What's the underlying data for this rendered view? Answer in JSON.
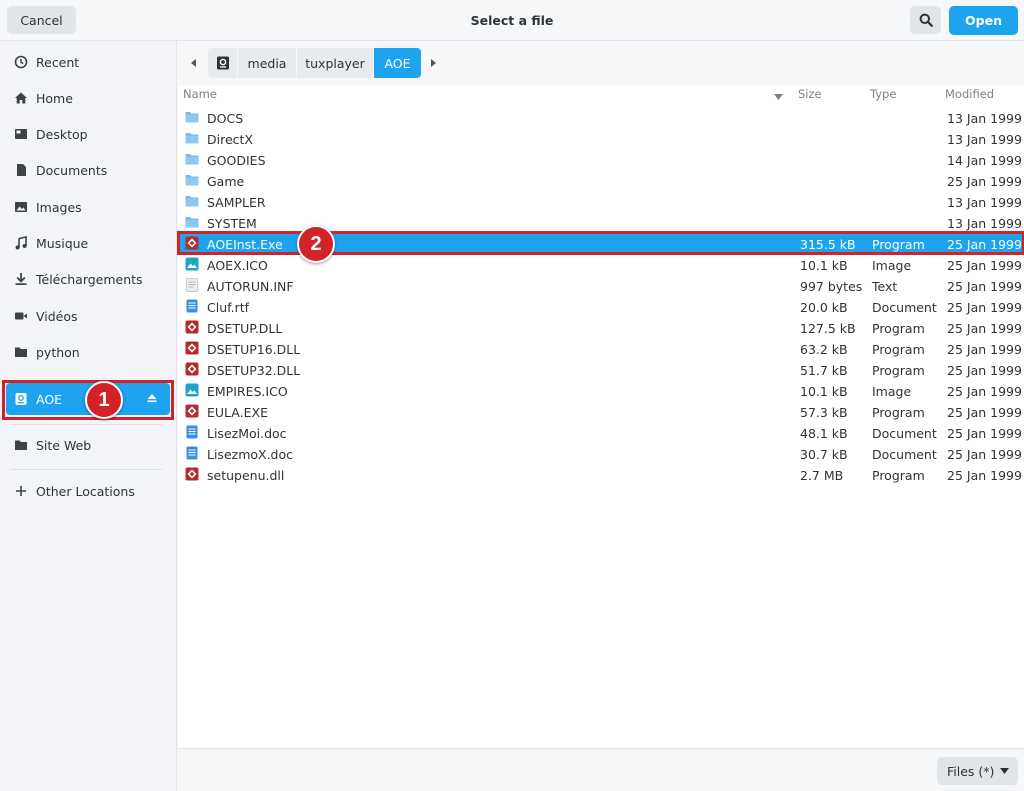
{
  "header": {
    "cancel_label": "Cancel",
    "title": "Select a file",
    "open_label": "Open",
    "accent": "#1ea4ef"
  },
  "sidebar": {
    "items": [
      {
        "label": "Recent",
        "icon": "clock-icon"
      },
      {
        "label": "Home",
        "icon": "home-icon"
      },
      {
        "label": "Desktop",
        "icon": "desktop-icon"
      },
      {
        "label": "Documents",
        "icon": "document-icon"
      },
      {
        "label": "Images",
        "icon": "image-icon"
      },
      {
        "label": "Musique",
        "icon": "music-icon"
      },
      {
        "label": "Téléchargements",
        "icon": "download-icon"
      },
      {
        "label": "Vidéos",
        "icon": "video-icon"
      },
      {
        "label": "python",
        "icon": "folder-icon"
      },
      {
        "label": "AOE",
        "icon": "drive-icon",
        "active": true
      },
      {
        "label": "Site Web",
        "icon": "folder-icon"
      },
      {
        "label": "Other Locations",
        "icon": "plus-icon"
      }
    ]
  },
  "callouts": [
    "1",
    "2"
  ],
  "pathbar": {
    "crumbs": [
      "media",
      "tuxplayer",
      "AOE"
    ]
  },
  "columns": {
    "name": "Name",
    "size": "Size",
    "type": "Type",
    "modified": "Modified"
  },
  "files": [
    {
      "name": "DOCS",
      "size": "",
      "type": "",
      "modified": "13 Jan 1999",
      "kind": "folder"
    },
    {
      "name": "DirectX",
      "size": "",
      "type": "",
      "modified": "13 Jan 1999",
      "kind": "folder"
    },
    {
      "name": "GOODIES",
      "size": "",
      "type": "",
      "modified": "14 Jan 1999",
      "kind": "folder"
    },
    {
      "name": "Game",
      "size": "",
      "type": "",
      "modified": "25 Jan 1999",
      "kind": "folder"
    },
    {
      "name": "SAMPLER",
      "size": "",
      "type": "",
      "modified": "13 Jan 1999",
      "kind": "folder"
    },
    {
      "name": "SYSTEM",
      "size": "",
      "type": "",
      "modified": "13 Jan 1999",
      "kind": "folder"
    },
    {
      "name": "AOEInst.Exe",
      "size": "315.5 kB",
      "type": "Program",
      "modified": "25 Jan 1999",
      "kind": "program",
      "selected": true
    },
    {
      "name": "AOEX.ICO",
      "size": "10.1 kB",
      "type": "Image",
      "modified": "25 Jan 1999",
      "kind": "image"
    },
    {
      "name": "AUTORUN.INF",
      "size": "997 bytes",
      "type": "Text",
      "modified": "25 Jan 1999",
      "kind": "text"
    },
    {
      "name": "Cluf.rtf",
      "size": "20.0 kB",
      "type": "Document",
      "modified": "25 Jan 1999",
      "kind": "document"
    },
    {
      "name": "DSETUP.DLL",
      "size": "127.5 kB",
      "type": "Program",
      "modified": "25 Jan 1999",
      "kind": "program"
    },
    {
      "name": "DSETUP16.DLL",
      "size": "63.2 kB",
      "type": "Program",
      "modified": "25 Jan 1999",
      "kind": "program"
    },
    {
      "name": "DSETUP32.DLL",
      "size": "51.7 kB",
      "type": "Program",
      "modified": "25 Jan 1999",
      "kind": "program"
    },
    {
      "name": "EMPIRES.ICO",
      "size": "10.1 kB",
      "type": "Image",
      "modified": "25 Jan 1999",
      "kind": "image"
    },
    {
      "name": "EULA.EXE",
      "size": "57.3 kB",
      "type": "Program",
      "modified": "25 Jan 1999",
      "kind": "program"
    },
    {
      "name": "LisezMoi.doc",
      "size": "48.1 kB",
      "type": "Document",
      "modified": "25 Jan 1999",
      "kind": "document"
    },
    {
      "name": "LisezmoX.doc",
      "size": "30.7 kB",
      "type": "Document",
      "modified": "25 Jan 1999",
      "kind": "document"
    },
    {
      "name": "setupenu.dll",
      "size": "2.7 MB",
      "type": "Program",
      "modified": "25 Jan 1999",
      "kind": "program"
    }
  ],
  "footer": {
    "filter_label": "Files (*)"
  }
}
